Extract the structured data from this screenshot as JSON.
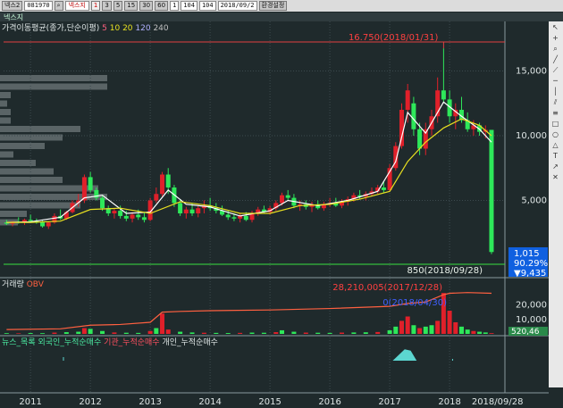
{
  "toolbar": {
    "window_label": "넥스2",
    "code": "081970",
    "name": "넥스지",
    "period_buttons": [
      "1",
      "3",
      "5",
      "15",
      "30",
      "60"
    ],
    "period_unit": "1",
    "count_a": "104",
    "count_b": "104",
    "date": "2018/09/2",
    "settings_label": "환경설정"
  },
  "title_strip": "넥스지",
  "legends": {
    "price": {
      "title": "가격이동평균(종가,단순이평)",
      "periods": [
        "5",
        "10",
        "20",
        "120",
        "240"
      ]
    },
    "volume": {
      "title": "거래량",
      "obv": "OBV"
    },
    "flows": {
      "items": [
        "뉴스_목록",
        "외국인_누적순매수",
        "기관_누적순매수",
        "개인_누적순매수"
      ]
    }
  },
  "colors": {
    "background": "#1f2a2c",
    "up": "#e0202a",
    "down": "#2ee85a",
    "ma5": "#ffffff",
    "ma20": "#e8e020",
    "obv": "#ff6040",
    "grid": "#3c4a4e",
    "mountain": "#5cd6d0"
  },
  "annotations": {
    "high": "16.750(2018/01/31)",
    "low": "850(2018/09/28)",
    "volume_high": "28,210,005(2017/12/28)",
    "volume_point": "0(2018/04/30)"
  },
  "badges": {
    "last_price": "1,015",
    "change_pct": "90.29%",
    "change_amount": "▼9,435",
    "volume_last": "520,46"
  },
  "chart_data": [
    {
      "type": "candlestick",
      "title": "가격이동평균(종가,단순이평)",
      "ylim": [
        0,
        18000
      ],
      "yticks": [
        "5,000",
        "10,000",
        "15,000"
      ],
      "ytick_values": [
        5000,
        10000,
        15000
      ],
      "xticks": [
        "2011",
        "2012",
        "2013",
        "2014",
        "2015",
        "2016",
        "2017",
        "2018",
        "2018/09/28"
      ],
      "xtick_values": [
        2011.0,
        2012.0,
        2013.0,
        2014.0,
        2015.0,
        2016.0,
        2017.0,
        2018.0,
        2018.74
      ],
      "x_range": [
        2010.55,
        2018.76
      ],
      "series": [
        {
          "name": "5",
          "kind": "ohlc",
          "values": [
            [
              2010.6,
              3300,
              3500,
              3100,
              3200
            ],
            [
              2010.7,
              3200,
              3400,
              3000,
              3350
            ],
            [
              2010.8,
              3350,
              3700,
              3200,
              3300
            ],
            [
              2010.9,
              3300,
              3600,
              3100,
              3500
            ],
            [
              2011.0,
              3500,
              3900,
              3300,
              3400
            ],
            [
              2011.1,
              3400,
              3600,
              3200,
              3300
            ],
            [
              2011.2,
              3300,
              3500,
              2900,
              3000
            ],
            [
              2011.3,
              3000,
              3400,
              2800,
              3300
            ],
            [
              2011.4,
              3300,
              4000,
              3200,
              3800
            ],
            [
              2011.5,
              3800,
              4300,
              3500,
              3600
            ],
            [
              2011.6,
              3600,
              4200,
              3500,
              4100
            ],
            [
              2011.7,
              4100,
              5000,
              4000,
              4800
            ],
            [
              2011.8,
              4800,
              5500,
              4500,
              5000
            ],
            [
              2011.9,
              5000,
              7000,
              4800,
              6800
            ],
            [
              2012.0,
              6800,
              7200,
              5600,
              5800
            ],
            [
              2012.1,
              5800,
              6000,
              5000,
              5200
            ],
            [
              2012.2,
              5200,
              5400,
              4200,
              4400
            ],
            [
              2012.3,
              4400,
              4600,
              3800,
              4000
            ],
            [
              2012.4,
              4000,
              4400,
              3600,
              4200
            ],
            [
              2012.5,
              4200,
              4600,
              3600,
              3800
            ],
            [
              2012.6,
              3800,
              4200,
              3400,
              3600
            ],
            [
              2012.7,
              3600,
              4100,
              3300,
              3900
            ],
            [
              2012.8,
              3900,
              4300,
              3500,
              3700
            ],
            [
              2012.9,
              3700,
              4100,
              3300,
              3500
            ],
            [
              2013.0,
              3500,
              5200,
              3400,
              5000
            ],
            [
              2013.1,
              5000,
              6000,
              4800,
              5500
            ],
            [
              2013.2,
              5500,
              7200,
              5300,
              7000
            ],
            [
              2013.3,
              7000,
              7500,
              5500,
              6000
            ],
            [
              2013.4,
              6000,
              6200,
              4500,
              4800
            ],
            [
              2013.5,
              4800,
              5100,
              3800,
              4000
            ],
            [
              2013.6,
              4000,
              4500,
              3600,
              4300
            ],
            [
              2013.7,
              4300,
              4800,
              3800,
              4000
            ],
            [
              2013.8,
              4000,
              4600,
              3700,
              4400
            ],
            [
              2013.9,
              4400,
              5000,
              4000,
              4600
            ],
            [
              2014.0,
              4600,
              5200,
              4200,
              4400
            ],
            [
              2014.1,
              4400,
              4800,
              4000,
              4200
            ],
            [
              2014.2,
              4200,
              4600,
              3800,
              3900
            ],
            [
              2014.3,
              3900,
              4200,
              3500,
              3700
            ],
            [
              2014.4,
              3700,
              4000,
              3400,
              3600
            ],
            [
              2014.5,
              3600,
              4000,
              3300,
              3800
            ],
            [
              2014.6,
              3800,
              4100,
              3400,
              3500
            ],
            [
              2014.7,
              3500,
              4200,
              3300,
              4000
            ],
            [
              2014.8,
              4000,
              4500,
              3800,
              4300
            ],
            [
              2014.9,
              4300,
              4600,
              4000,
              4100
            ],
            [
              2015.0,
              4100,
              4600,
              3900,
              4400
            ],
            [
              2015.1,
              4400,
              5000,
              4200,
              4800
            ],
            [
              2015.2,
              4800,
              5600,
              4600,
              5400
            ],
            [
              2015.3,
              5400,
              5800,
              5000,
              5200
            ],
            [
              2015.4,
              5200,
              5500,
              4400,
              4600
            ],
            [
              2015.5,
              4600,
              5000,
              4200,
              4700
            ],
            [
              2015.6,
              4700,
              5000,
              4300,
              4500
            ],
            [
              2015.7,
              4500,
              4900,
              4100,
              4700
            ],
            [
              2015.8,
              4700,
              5000,
              4300,
              4400
            ],
            [
              2015.9,
              4400,
              4900,
              4200,
              4700
            ],
            [
              2016.0,
              4700,
              5200,
              4500,
              4800
            ],
            [
              2016.1,
              4800,
              5200,
              4500,
              4600
            ],
            [
              2016.2,
              4600,
              5100,
              4400,
              4900
            ],
            [
              2016.3,
              4900,
              5300,
              4600,
              5100
            ],
            [
              2016.4,
              5100,
              5600,
              4900,
              5400
            ],
            [
              2016.5,
              5400,
              5800,
              5100,
              5300
            ],
            [
              2016.6,
              5300,
              5700,
              5000,
              5500
            ],
            [
              2016.7,
              5500,
              6000,
              5300,
              5700
            ],
            [
              2016.8,
              5700,
              6200,
              5500,
              6000
            ],
            [
              2016.9,
              6000,
              6500,
              5600,
              5800
            ],
            [
              2017.0,
              5800,
              7800,
              5700,
              7500
            ],
            [
              2017.1,
              7500,
              9500,
              7300,
              9200
            ],
            [
              2017.2,
              9200,
              12500,
              9000,
              12000
            ],
            [
              2017.3,
              12000,
              14000,
              11000,
              13500
            ],
            [
              2017.4,
              12500,
              13000,
              10000,
              10500
            ],
            [
              2017.5,
              10500,
              11000,
              8500,
              9000
            ],
            [
              2017.6,
              9000,
              11000,
              8500,
              10500
            ],
            [
              2017.7,
              10500,
              12000,
              10000,
              11500
            ],
            [
              2017.8,
              11500,
              14500,
              11000,
              13500
            ],
            [
              2017.9,
              13500,
              16750,
              12500,
              12800
            ],
            [
              2018.0,
              12800,
              13500,
              11000,
              11500
            ],
            [
              2018.1,
              11500,
              12500,
              10500,
              12000
            ],
            [
              2018.2,
              12000,
              13000,
              11000,
              11200
            ],
            [
              2018.3,
              11200,
              11800,
              10300,
              10500
            ],
            [
              2018.4,
              10500,
              11200,
              10000,
              10800
            ],
            [
              2018.5,
              10800,
              11000,
              10000,
              10300
            ],
            [
              2018.6,
              10300,
              10800,
              9800,
              10450
            ],
            [
              2018.7,
              10450,
              10450,
              850,
              1015
            ]
          ]
        },
        {
          "name": "ma5",
          "kind": "line",
          "values": [
            [
              2010.6,
              3300
            ],
            [
              2011.0,
              3350
            ],
            [
              2011.5,
              3700
            ],
            [
              2011.9,
              5200
            ],
            [
              2012.2,
              5400
            ],
            [
              2012.6,
              4000
            ],
            [
              2013.0,
              4100
            ],
            [
              2013.3,
              5800
            ],
            [
              2013.6,
              4700
            ],
            [
              2014.0,
              4500
            ],
            [
              2014.5,
              3800
            ],
            [
              2015.0,
              4200
            ],
            [
              2015.3,
              5000
            ],
            [
              2015.8,
              4600
            ],
            [
              2016.3,
              5000
            ],
            [
              2016.8,
              5700
            ],
            [
              2017.1,
              8000
            ],
            [
              2017.3,
              11800
            ],
            [
              2017.6,
              10200
            ],
            [
              2017.9,
              12600
            ],
            [
              2018.2,
              11500
            ],
            [
              2018.5,
              10500
            ],
            [
              2018.7,
              9500
            ]
          ]
        },
        {
          "name": "ma20",
          "kind": "line",
          "values": [
            [
              2010.6,
              3300
            ],
            [
              2011.0,
              3300
            ],
            [
              2011.5,
              3400
            ],
            [
              2012.0,
              4300
            ],
            [
              2012.5,
              4400
            ],
            [
              2013.0,
              4000
            ],
            [
              2013.5,
              4900
            ],
            [
              2014.0,
              4600
            ],
            [
              2014.5,
              4000
            ],
            [
              2015.0,
              4000
            ],
            [
              2015.5,
              4600
            ],
            [
              2016.0,
              4700
            ],
            [
              2016.5,
              5100
            ],
            [
              2017.0,
              5700
            ],
            [
              2017.3,
              8000
            ],
            [
              2017.6,
              9500
            ],
            [
              2017.9,
              10600
            ],
            [
              2018.2,
              11300
            ],
            [
              2018.5,
              10800
            ],
            [
              2018.7,
              10000
            ]
          ]
        }
      ]
    },
    {
      "type": "bar",
      "title": "거래량",
      "ylim": [
        0,
        32000000
      ],
      "yticks": [
        "10,000",
        "20,000"
      ],
      "ytick_values": [
        10000000,
        20000000
      ],
      "x_range": [
        2010.55,
        2018.76
      ],
      "series": [
        {
          "name": "거래량",
          "x": [
            2010.6,
            2010.8,
            2011.0,
            2011.2,
            2011.4,
            2011.6,
            2011.8,
            2011.9,
            2012.0,
            2012.2,
            2012.4,
            2012.6,
            2012.8,
            2013.0,
            2013.1,
            2013.2,
            2013.3,
            2013.5,
            2013.7,
            2013.9,
            2014.1,
            2014.3,
            2014.5,
            2014.7,
            2014.9,
            2015.1,
            2015.2,
            2015.4,
            2015.6,
            2015.8,
            2016.0,
            2016.2,
            2016.4,
            2016.6,
            2016.8,
            2017.0,
            2017.1,
            2017.2,
            2017.3,
            2017.4,
            2017.5,
            2017.6,
            2017.7,
            2017.8,
            2017.9,
            2018.0,
            2018.1,
            2018.2,
            2018.3,
            2018.4,
            2018.5,
            2018.6,
            2018.7
          ],
          "values": [
            500000,
            400000,
            600000,
            500000,
            900000,
            1200000,
            1500000,
            4000000,
            3500000,
            2000000,
            1000000,
            800000,
            700000,
            2000000,
            4000000,
            14000000,
            3000000,
            1500000,
            1000000,
            800000,
            700000,
            600000,
            700000,
            900000,
            800000,
            1200000,
            2500000,
            1500000,
            900000,
            800000,
            700000,
            900000,
            1000000,
            1100000,
            1300000,
            2500000,
            5000000,
            9000000,
            12000000,
            6000000,
            4000000,
            5000000,
            6000000,
            9000000,
            28210005,
            16000000,
            8000000,
            5000000,
            3000000,
            2000000,
            1500000,
            1000000,
            520460
          ]
        },
        {
          "name": "OBV",
          "x": [
            2010.6,
            2011.5,
            2012.0,
            2012.5,
            2013.0,
            2013.2,
            2013.5,
            2014.0,
            2015.0,
            2016.0,
            2017.0,
            2017.3,
            2017.6,
            2017.9,
            2018.0,
            2018.3,
            2018.7
          ],
          "values": [
            3000000,
            3500000,
            6000000,
            6500000,
            8000000,
            15000000,
            15500000,
            16000000,
            16500000,
            17500000,
            19000000,
            21000000,
            22000000,
            27000000,
            28000000,
            28500000,
            28000000
          ]
        }
      ]
    },
    {
      "type": "area",
      "title": "개인_누적순매수",
      "series": [
        {
          "name": "개인_누적순매수",
          "x": [
            2017.05,
            2017.15,
            2017.25,
            2017.35,
            2017.45
          ],
          "values": [
            0,
            4,
            8,
            7,
            0
          ]
        }
      ]
    }
  ]
}
